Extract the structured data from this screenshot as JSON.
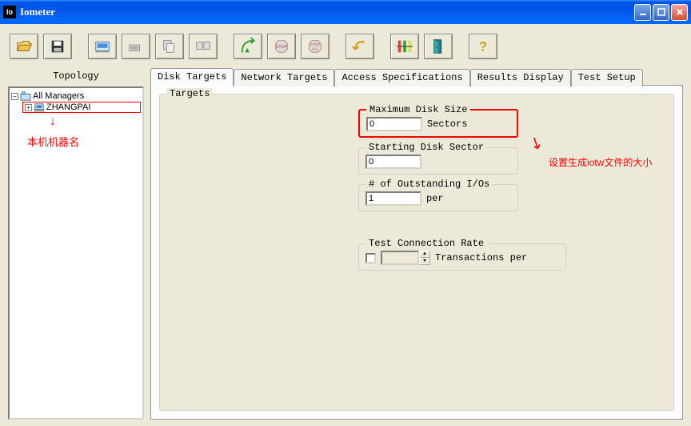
{
  "window": {
    "title": "Iometer"
  },
  "topology": {
    "header": "Topology",
    "root_label": "All Managers",
    "child_label": "ZHANGPAI",
    "annotation": "本机机器名"
  },
  "tabs": {
    "disk_targets": "Disk Targets",
    "network_targets": "Network Targets",
    "access_specs": "Access Specifications",
    "results_display": "Results Display",
    "test_setup": "Test Setup"
  },
  "targets": {
    "legend": "Targets",
    "max_disk_size": {
      "legend": "Maximum Disk Size",
      "value": "0",
      "unit": "Sectors"
    },
    "starting_sector": {
      "legend": "Starting Disk Sector",
      "value": "0"
    },
    "outstanding_ios": {
      "legend": "# of Outstanding I/Os",
      "value": "1",
      "unit": "per"
    },
    "test_conn_rate": {
      "legend": "Test Connection Rate",
      "unit": "Transactions per"
    },
    "annotation_right": "设置生成iotw文件的大小"
  }
}
